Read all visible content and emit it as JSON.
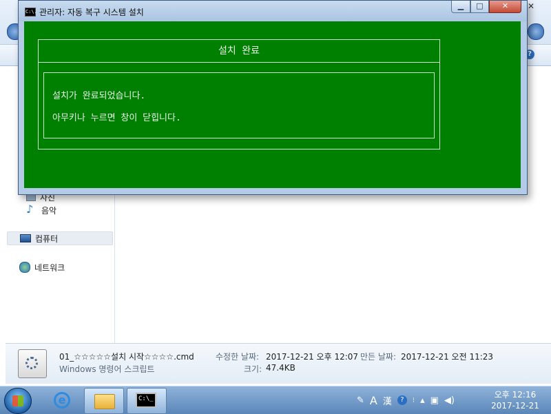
{
  "cmd": {
    "title": "관리자:  자동 복구 시스템 설치",
    "icon_glyph": "C:\\.",
    "buttons": {
      "minimize": "▁",
      "maximize": "□",
      "close": "✕"
    },
    "dialog": {
      "title": "설치 완료",
      "line1": "설치가 완료되었습니다.",
      "line2": "아무키나 누르면 창이 닫힙니다."
    },
    "colors": {
      "background": "#008000",
      "text": "#e8f2e8"
    }
  },
  "explorer": {
    "nav": [
      {
        "label": "사진",
        "icon": "photo-icon"
      },
      {
        "label": "음악",
        "icon": "music-icon"
      },
      {
        "label": "컴퓨터",
        "icon": "computer-icon"
      },
      {
        "label": "네트워크",
        "icon": "network-icon"
      }
    ],
    "help": "?",
    "details": {
      "filename": "01_☆☆☆☆☆설치 시작☆☆☆☆.cmd",
      "type": "Windows 명령어 스크립트",
      "modified_label": "수정한 날짜:",
      "modified_value": "2017-12-21 오후 12:07",
      "created_label": "만든 날짜:",
      "created_value": "2017-12-21 오전 11:23",
      "size_label": "크기:",
      "size_value": "47.4KB"
    }
  },
  "taskbar": {
    "cmd_icon_text": "C:\\_",
    "ie_glyph": "e",
    "tray": {
      "lang_a": "A",
      "lang_han": "漢",
      "help": "?",
      "arrow": "▴"
    },
    "clock": {
      "time": "오후 12:16",
      "date": "2017-12-21"
    }
  }
}
